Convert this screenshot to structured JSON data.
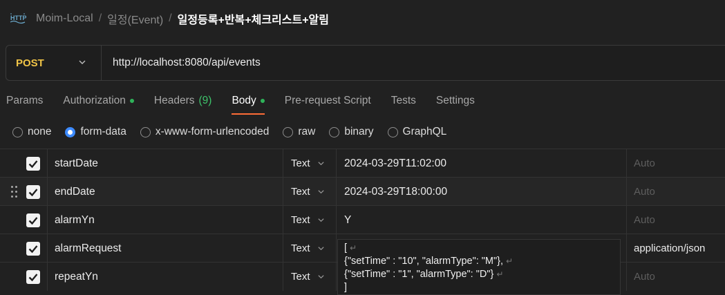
{
  "breadcrumb": {
    "items": [
      "Moim-Local",
      "일정(Event)"
    ],
    "separator": "/",
    "current": "일정등록+반복+체크리스트+알림",
    "icon": "http-icon"
  },
  "request": {
    "method": "POST",
    "url": "http://localhost:8080/api/events"
  },
  "tabs": [
    {
      "label": "Params"
    },
    {
      "label": "Authorization",
      "dot": true
    },
    {
      "label": "Headers",
      "count": "(9)"
    },
    {
      "label": "Body",
      "dot": true,
      "active": true
    },
    {
      "label": "Pre-request Script"
    },
    {
      "label": "Tests"
    },
    {
      "label": "Settings"
    }
  ],
  "body_types": [
    {
      "label": "none",
      "checked": false
    },
    {
      "label": "form-data",
      "checked": true
    },
    {
      "label": "x-www-form-urlencoded",
      "checked": false
    },
    {
      "label": "raw",
      "checked": false
    },
    {
      "label": "binary",
      "checked": false
    },
    {
      "label": "GraphQL",
      "checked": false
    }
  ],
  "form_rows": [
    {
      "key": "startDate",
      "type": "Text",
      "value": "2024-03-29T11:02:00",
      "content_type": "Auto",
      "checked": true
    },
    {
      "key": "endDate",
      "type": "Text",
      "value": "2024-03-29T18:00:00",
      "content_type": "Auto",
      "checked": true
    },
    {
      "key": "alarmYn",
      "type": "Text",
      "value": "Y",
      "content_type": "Auto",
      "checked": true
    },
    {
      "key": "alarmRequest",
      "type": "Text",
      "value": "",
      "content_type": "application/json",
      "checked": true
    },
    {
      "key": "repeatYn",
      "type": "Text",
      "value": "",
      "content_type": "Auto",
      "checked": true
    }
  ],
  "editor_lines": [
    "[",
    "{\"setTime\" : \"10\", \"alarmType\": \"M\"},",
    "{\"setTime\" : \"1\", \"alarmType\": \"D\"}",
    "]"
  ],
  "colors": {
    "method": "#f0c447",
    "dot": "#2fb35a",
    "radio_checked": "#3d8bff",
    "tab_underline": "#ff6c37"
  }
}
